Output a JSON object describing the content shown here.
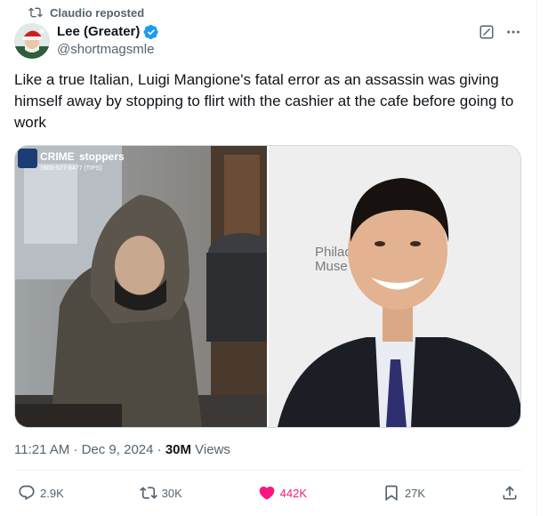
{
  "repost": {
    "label": "Claudio reposted",
    "icon": "retweet-icon"
  },
  "author": {
    "name": "Lee (Greater)",
    "handle": "@shortmagsmle",
    "verified_color": "#1d9bf0",
    "avatar_icon": "santa-hat-avatar"
  },
  "header_actions": {
    "grok_icon": "grok-icon",
    "more_icon": "more-dots-icon"
  },
  "tweet": {
    "text": "Like a true Italian, Luigi Mangione's fatal error as an assassin was giving himself away by stopping to flirt with the cashier at the cafe before going to work"
  },
  "media": {
    "left_image": {
      "overlay_title_a": "CRIME",
      "overlay_title_b": "stoppers",
      "overlay_phone": "1800-577-8477 (TIPS)"
    },
    "right_image": {
      "backdrop_text_line1": "Philad",
      "backdrop_text_line2": "Muse"
    }
  },
  "meta": {
    "time": "11:21 AM · Dec 9, 2024 · ",
    "views_count": "30M",
    "views_label": " Views"
  },
  "actions": {
    "replies": "2.9K",
    "reposts": "30K",
    "likes": "442K",
    "bookmarks": "27K",
    "like_color": "#f91880"
  }
}
